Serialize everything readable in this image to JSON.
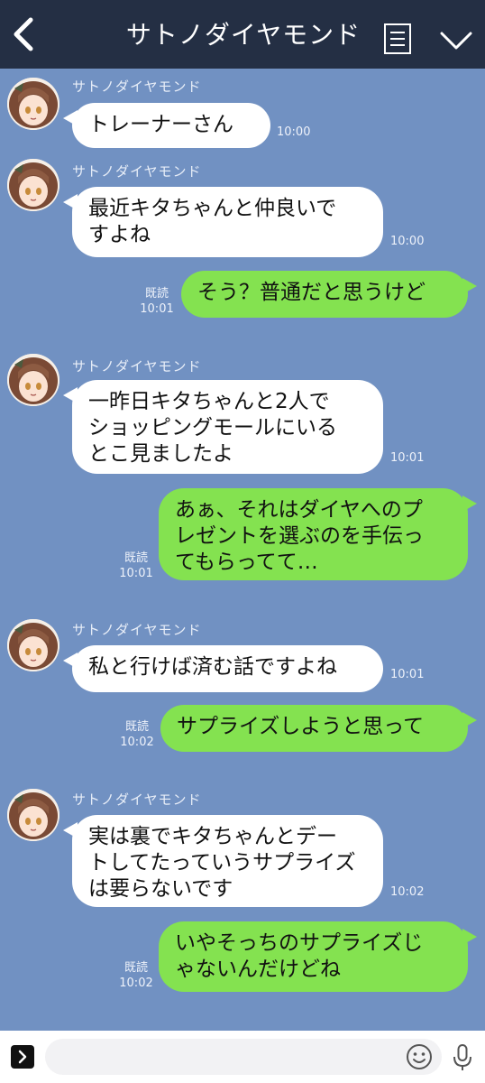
{
  "header": {
    "title": "サトノダイヤモンド",
    "background": "#242f44"
  },
  "chat": {
    "background": "#7191c2",
    "sender_name": "サトノダイヤモンド",
    "read_label": "既読",
    "incoming_bubble_color": "#ffffff",
    "outgoing_bubble_color": "#84e250",
    "messages": [
      {
        "direction": "in",
        "lines": [
          "トレーナーさん"
        ],
        "time": "10:00"
      },
      {
        "direction": "in",
        "lines": [
          "最近キタちゃんと仲良いで",
          "すよね"
        ],
        "time": "10:00"
      },
      {
        "direction": "out",
        "lines": [
          "そう？普通だと思うけど"
        ],
        "read": "既読",
        "time": "10:01"
      },
      {
        "direction": "in",
        "lines": [
          "一昨日キタちゃんと2人で",
          "ショッピングモールにいる",
          "とこ見ましたよ"
        ],
        "time": "10:01"
      },
      {
        "direction": "out",
        "lines": [
          "あぁ、それはダイヤへのプ",
          "レゼントを選ぶのを手伝っ",
          "てもらってて…"
        ],
        "read": "既読",
        "time": "10:01"
      },
      {
        "direction": "in",
        "lines": [
          "私と行けば済む話ですよね"
        ],
        "time": "10:01"
      },
      {
        "direction": "out",
        "lines": [
          "サプライズしようと思って"
        ],
        "read": "既読",
        "time": "10:02"
      },
      {
        "direction": "in",
        "lines": [
          "実は裏でキタちゃんとデー",
          "トしてたっていうサプライズ",
          "は要らないです"
        ],
        "time": "10:02"
      },
      {
        "direction": "out",
        "lines": [
          "いやそっちのサプライズじ",
          "ゃないんだけどね"
        ],
        "read": "既読",
        "time": "10:02"
      }
    ]
  },
  "footer": {
    "input_value": "",
    "icons": [
      "expand-icon",
      "emoji-icon",
      "microphone-icon"
    ]
  }
}
